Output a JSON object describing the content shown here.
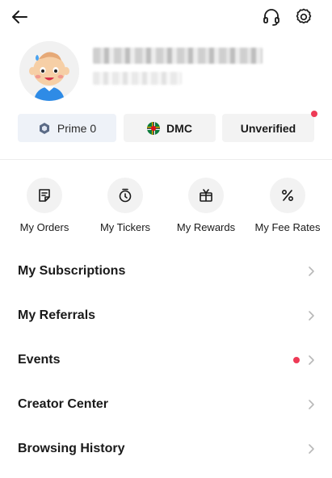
{
  "header": {
    "back_icon": "arrow-left-icon",
    "support_icon": "headset-icon",
    "settings_icon": "gear-icon"
  },
  "profile": {
    "avatar": "cartoon-baby-avatar"
  },
  "badges": {
    "prime_label": "Prime 0",
    "region_label": "DMC",
    "verify_label": "Unverified"
  },
  "shortcuts": [
    {
      "label": "My Orders",
      "icon": "orders-icon"
    },
    {
      "label": "My Tickers",
      "icon": "timer-icon"
    },
    {
      "label": "My Rewards",
      "icon": "gift-icon"
    },
    {
      "label": "My Fee Rates",
      "icon": "percent-icon"
    }
  ],
  "menu": [
    {
      "label": "My Subscriptions"
    },
    {
      "label": "My Referrals"
    },
    {
      "label": "Events"
    },
    {
      "label": "Creator Center"
    },
    {
      "label": "Browsing History"
    }
  ],
  "colors": {
    "notification": "#ee3a56",
    "pill_bg": "#f3f3f3",
    "prime_bg": "#eef2f8"
  }
}
